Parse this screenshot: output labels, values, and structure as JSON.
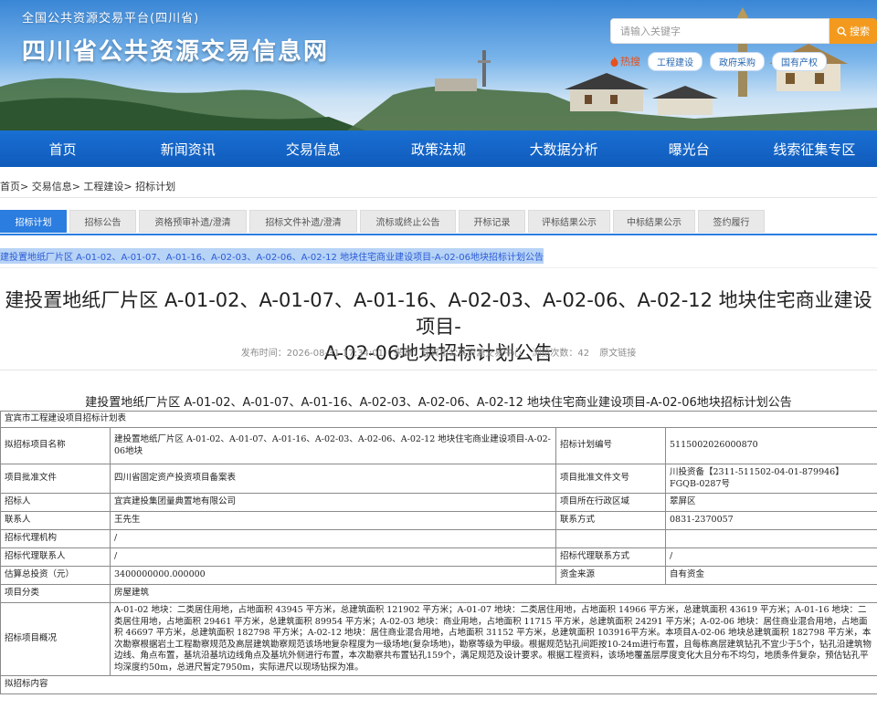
{
  "header": {
    "platform_name": "全国公共资源交易平台(四川省)",
    "site_title": "四川省公共资源交易信息网",
    "search_placeholder": "请输入关键字",
    "search_button": "搜索",
    "hot_label": "热搜",
    "quick_links": [
      "工程建设",
      "政府采购",
      "国有产权"
    ]
  },
  "nav": [
    "首页",
    "新闻资讯",
    "交易信息",
    "政策法规",
    "大数据分析",
    "曝光台",
    "线索征集专区"
  ],
  "breadcrumb": "首页> 交易信息> 工程建设> 招标计划",
  "tabs": [
    "招标计划",
    "招标公告",
    "资格预审补遗/澄清",
    "招标文件补遗/澄清",
    "流标或终止公告",
    "开标记录",
    "评标结果公示",
    "中标结果公示",
    "签约履行"
  ],
  "selected_link": "建投置地纸厂片区 A-01-02、A-01-07、A-01-16、A-02-03、A-02-06、A-02-12 地块住宅商业建设项目-A-02-06地块招标计划公告",
  "article": {
    "title_line1": "建投置地纸厂片区 A-01-02、A-01-07、A-01-16、A-02-03、A-02-06、A-02-12 地块住宅商业建设项目-",
    "title_line2": "A-02-06地块招标计划公告",
    "publish_time": "发布时间：2026-08-31 17:34:01",
    "source": "来源：宜宾市公共资源交易中心",
    "views": "浏览次数：42",
    "original_link": "原文链接"
  },
  "table_title": "建投置地纸厂片区 A-01-02、A-01-07、A-01-16、A-02-03、A-02-06、A-02-12 地块住宅商业建设项目-A-02-06地块招标计划公告",
  "table": {
    "header": "宜宾市工程建设项目招标计划表",
    "rows": [
      {
        "l1": "拟招标项目名称",
        "v1": "建投置地纸厂片区 A-01-02、A-01-07、A-01-16、A-02-03、A-02-06、A-02-12 地块住宅商业建设项目-A-02-06地块",
        "l2": "招标计划编号",
        "v2": "5115002026000870"
      },
      {
        "l1": "项目批准文件",
        "v1": "四川省固定资产投资项目备案表",
        "l2": "项目批准文件文号",
        "v2": "川投资备【2311-511502-04-01-879946】FGQB-0287号"
      },
      {
        "l1": "招标人",
        "v1": "宜宾建投集团量典置地有限公司",
        "l2": "项目所在行政区域",
        "v2": "翠屏区"
      },
      {
        "l1": "联系人",
        "v1": "王先生",
        "l2": "联系方式",
        "v2": "0831-2370057"
      },
      {
        "l1": "招标代理机构",
        "v1": "/",
        "l2": "",
        "v2": ""
      },
      {
        "l1": "招标代理联系人",
        "v1": "/",
        "l2": "招标代理联系方式",
        "v2": "/"
      },
      {
        "l1": "估算总投资（元）",
        "v1": "3400000000.000000",
        "l2": "资金来源",
        "v2": "自有资金"
      }
    ],
    "category_label": "项目分类",
    "category_value": "房屋建筑",
    "overview_label": "招标项目概况",
    "overview_value": "A-01-02 地块：二类居住用地，占地面积 43945 平方米，总建筑面积 121902 平方米；A-01-07 地块：二类居住用地，占地面积 14966 平方米，总建筑面积 43619 平方米；A-01-16 地块：二类居住用地，占地面积 29461 平方米，总建筑面积 89954 平方米；A-02-03 地块：商业用地，占地面积 11715 平方米，总建筑面积 24291 平方米；A-02-06 地块：居住商业混合用地，占地面积 46697 平方米，总建筑面积 182798 平方米；A-02-12 地块：居住商业混合用地，占地面积 31152 平方米，总建筑面积 103916平方米。本项目A-02-06 地块总建筑面积 182798 平方米，本次勘察根据岩土工程勘察规范及高层建筑勘察规范该场地复杂程度为一级场地(复杂场地)，勘察等级为甲级。根据规范钻孔间距按10-24m进行布置，且每栋高层建筑钻孔不宜少于5个，钻孔沿建筑物边线、角点布置，基坑沿基坑边线角点及基坑外侧进行布置，本次勘察共布置钻孔159个，满足规范及设计要求。根据工程资料，该场地覆盖层厚度变化大且分布不均匀，地质条件复杂，预估钻孔平均深度约50m，总进尺暂定7950m，实际进尺以现场钻探为准。",
    "content_label": "拟招标内容"
  }
}
